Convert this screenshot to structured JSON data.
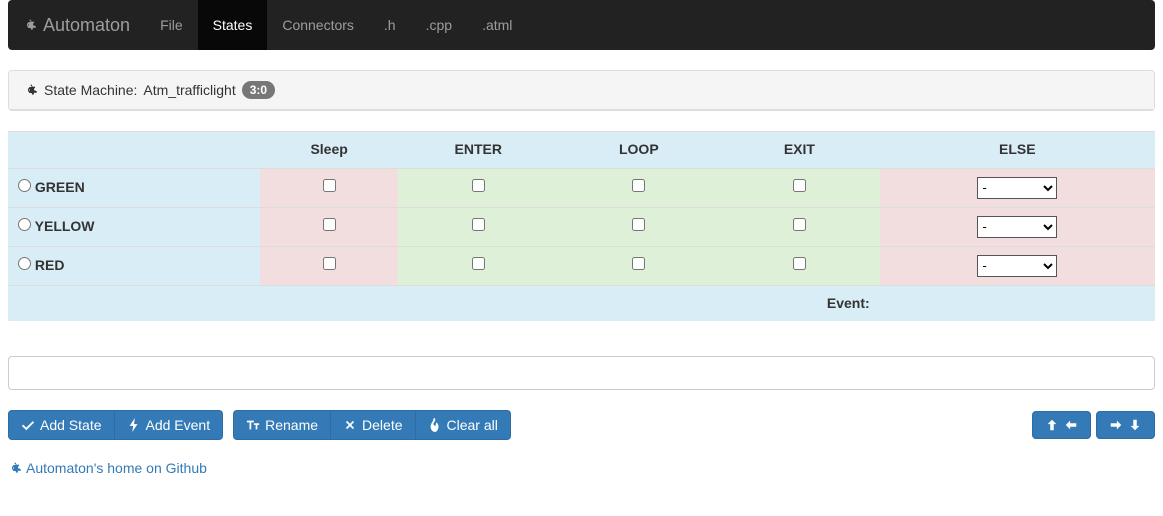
{
  "navbar": {
    "brand": "Automaton",
    "items": [
      {
        "label": "File",
        "active": false
      },
      {
        "label": "States",
        "active": true
      },
      {
        "label": "Connectors",
        "active": false
      },
      {
        "label": ".h",
        "active": false
      },
      {
        "label": ".cpp",
        "active": false
      },
      {
        "label": ".atml",
        "active": false
      }
    ]
  },
  "panel": {
    "title_prefix": "State Machine:",
    "machine_name": "Atm_trafficlight",
    "badge": "3:0"
  },
  "table": {
    "headers": [
      "",
      "Sleep",
      "ENTER",
      "LOOP",
      "EXIT",
      "ELSE"
    ],
    "rows": [
      {
        "name": "GREEN",
        "sleep": false,
        "enter": false,
        "loop": false,
        "exit": false,
        "else": "-"
      },
      {
        "name": "YELLOW",
        "sleep": false,
        "enter": false,
        "loop": false,
        "exit": false,
        "else": "-"
      },
      {
        "name": "RED",
        "sleep": false,
        "enter": false,
        "loop": false,
        "exit": false,
        "else": "-"
      }
    ],
    "else_options": [
      "-"
    ],
    "footer_label": "Event:"
  },
  "input": {
    "value": ""
  },
  "buttons": {
    "add_state": "Add State",
    "add_event": "Add Event",
    "rename": "Rename",
    "delete": "Delete",
    "clear_all": "Clear all"
  },
  "footer": {
    "link_text": "Automaton's home on Github"
  }
}
